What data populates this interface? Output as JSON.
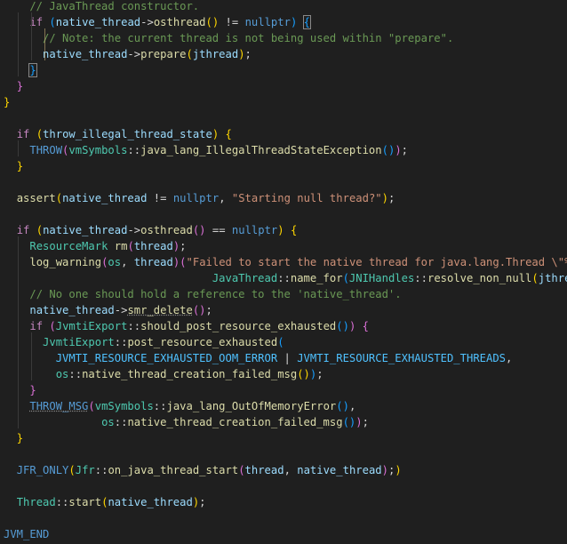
{
  "editor": {
    "lines": [
      {
        "kind": "plain",
        "text": "    // JavaThread constructor."
      },
      {
        "kind": "l01"
      },
      {
        "kind": "l02"
      },
      {
        "kind": "l03"
      },
      {
        "kind": "l04"
      },
      {
        "kind": "l05"
      },
      {
        "kind": "l06"
      },
      {
        "kind": "blank"
      },
      {
        "kind": "l08"
      },
      {
        "kind": "l09"
      },
      {
        "kind": "l10"
      },
      {
        "kind": "blank"
      },
      {
        "kind": "l12"
      },
      {
        "kind": "blank"
      },
      {
        "kind": "l14"
      },
      {
        "kind": "l15"
      },
      {
        "kind": "l16"
      },
      {
        "kind": "l17"
      },
      {
        "kind": "l18"
      },
      {
        "kind": "l19"
      },
      {
        "kind": "l20"
      },
      {
        "kind": "l21"
      },
      {
        "kind": "l22"
      },
      {
        "kind": "l23"
      },
      {
        "kind": "l24"
      },
      {
        "kind": "l25"
      },
      {
        "kind": "l26"
      },
      {
        "kind": "l27"
      },
      {
        "kind": "blank"
      },
      {
        "kind": "l29"
      },
      {
        "kind": "blank"
      },
      {
        "kind": "l31"
      },
      {
        "kind": "blank"
      },
      {
        "kind": "l33"
      }
    ]
  },
  "tokens": {
    "l01": [
      [
        "    ",
        "o"
      ],
      [
        "if",
        "k"
      ],
      [
        " ",
        "o"
      ],
      [
        "(",
        "b3"
      ],
      [
        "native_thread",
        "v"
      ],
      [
        "->",
        "o"
      ],
      [
        "osthread",
        "f"
      ],
      [
        "()",
        "b1"
      ],
      [
        " != ",
        "o"
      ],
      [
        "nullptr",
        "n"
      ],
      [
        ")",
        "b3"
      ],
      [
        " ",
        "o"
      ],
      [
        "{",
        "b3"
      ]
    ],
    "l02": [
      [
        "      ",
        "o"
      ],
      [
        "// Note: the current thread is not being used within \"prepare\".",
        "c"
      ]
    ],
    "l03": [
      [
        "      ",
        "o"
      ],
      [
        "native_thread",
        "v"
      ],
      [
        "->",
        "o"
      ],
      [
        "prepare",
        "f"
      ],
      [
        "(",
        "b1"
      ],
      [
        "jthread",
        "v"
      ],
      [
        ")",
        "b1"
      ],
      [
        ";",
        "o"
      ]
    ],
    "l04": [
      [
        "    ",
        "o"
      ],
      [
        "}",
        "b3"
      ]
    ],
    "l05": [
      [
        "  ",
        "o"
      ],
      [
        "}",
        "b2"
      ]
    ],
    "l06": [
      [
        "}",
        "b1"
      ]
    ],
    "l08": [
      [
        "  ",
        "o"
      ],
      [
        "if",
        "k"
      ],
      [
        " ",
        "o"
      ],
      [
        "(",
        "b1"
      ],
      [
        "throw_illegal_thread_state",
        "v"
      ],
      [
        ")",
        "b1"
      ],
      [
        " ",
        "o"
      ],
      [
        "{",
        "b1"
      ]
    ],
    "l09": [
      [
        "    ",
        "o"
      ],
      [
        "THROW",
        "n"
      ],
      [
        "(",
        "b2"
      ],
      [
        "vmSymbols",
        "t"
      ],
      [
        "::",
        "o"
      ],
      [
        "java_lang_IllegalThreadStateException",
        "f"
      ],
      [
        "()",
        "b3"
      ],
      [
        ")",
        "b2"
      ],
      [
        ";",
        "o"
      ]
    ],
    "l10": [
      [
        "  ",
        "o"
      ],
      [
        "}",
        "b1"
      ]
    ],
    "l12": [
      [
        "  ",
        "o"
      ],
      [
        "assert",
        "f"
      ],
      [
        "(",
        "b1"
      ],
      [
        "native_thread",
        "v"
      ],
      [
        " != ",
        "o"
      ],
      [
        "nullptr",
        "n"
      ],
      [
        ", ",
        "o"
      ],
      [
        "\"Starting null thread?\"",
        "s"
      ],
      [
        ")",
        "b1"
      ],
      [
        ";",
        "o"
      ]
    ],
    "l14": [
      [
        "  ",
        "o"
      ],
      [
        "if",
        "k"
      ],
      [
        " ",
        "o"
      ],
      [
        "(",
        "b1"
      ],
      [
        "native_thread",
        "v"
      ],
      [
        "->",
        "o"
      ],
      [
        "osthread",
        "f"
      ],
      [
        "()",
        "b2"
      ],
      [
        " == ",
        "o"
      ],
      [
        "nullptr",
        "n"
      ],
      [
        ")",
        "b1"
      ],
      [
        " ",
        "o"
      ],
      [
        "{",
        "b1"
      ]
    ],
    "l15": [
      [
        "    ",
        "o"
      ],
      [
        "ResourceMark",
        "t"
      ],
      [
        " ",
        "o"
      ],
      [
        "rm",
        "f"
      ],
      [
        "(",
        "b2"
      ],
      [
        "thread",
        "v"
      ],
      [
        ")",
        "b2"
      ],
      [
        ";",
        "o"
      ]
    ],
    "l16": [
      [
        "    ",
        "o"
      ],
      [
        "log_warning",
        "f"
      ],
      [
        "(",
        "b2"
      ],
      [
        "os",
        "t"
      ],
      [
        ", ",
        "o"
      ],
      [
        "thread",
        "v"
      ],
      [
        ")",
        "b2"
      ],
      [
        "(",
        "b2"
      ],
      [
        "\"Failed to start the native thread for java.lang.Thread \\\"%",
        "s"
      ]
    ],
    "l17": [
      [
        "                                ",
        "o"
      ],
      [
        "JavaThread",
        "t"
      ],
      [
        "::",
        "o"
      ],
      [
        "name_for",
        "f"
      ],
      [
        "(",
        "b3"
      ],
      [
        "JNIHandles",
        "t"
      ],
      [
        "::",
        "o"
      ],
      [
        "resolve_non_null",
        "f"
      ],
      [
        "(",
        "b1"
      ],
      [
        "jthread",
        "v"
      ],
      [
        ")",
        "b1"
      ],
      [
        ")",
        "b3"
      ]
    ],
    "l18": [
      [
        "    ",
        "o"
      ],
      [
        "// No one should hold a reference to the 'native_thread'.",
        "c"
      ]
    ],
    "l19": [
      [
        "    ",
        "o"
      ],
      [
        "native_thread",
        "v"
      ],
      [
        "->",
        "o"
      ],
      [
        "smr_delete",
        "f"
      ],
      [
        "()",
        "b2"
      ],
      [
        ";",
        "o"
      ]
    ],
    "l20": [
      [
        "    ",
        "o"
      ],
      [
        "if",
        "k"
      ],
      [
        " ",
        "o"
      ],
      [
        "(",
        "b2"
      ],
      [
        "JvmtiExport",
        "t"
      ],
      [
        "::",
        "o"
      ],
      [
        "should_post_resource_exhausted",
        "f"
      ],
      [
        "()",
        "b3"
      ],
      [
        ")",
        "b2"
      ],
      [
        " ",
        "o"
      ],
      [
        "{",
        "b2"
      ]
    ],
    "l21": [
      [
        "      ",
        "o"
      ],
      [
        "JvmtiExport",
        "t"
      ],
      [
        "::",
        "o"
      ],
      [
        "post_resource_exhausted",
        "f"
      ],
      [
        "(",
        "b3"
      ]
    ],
    "l22": [
      [
        "        ",
        "o"
      ],
      [
        "JVMTI_RESOURCE_EXHAUSTED_OOM_ERROR",
        "m"
      ],
      [
        " | ",
        "o"
      ],
      [
        "JVMTI_RESOURCE_EXHAUSTED_THREADS",
        "m"
      ],
      [
        ",",
        "o"
      ]
    ],
    "l23": [
      [
        "        ",
        "o"
      ],
      [
        "os",
        "t"
      ],
      [
        "::",
        "o"
      ],
      [
        "native_thread_creation_failed_msg",
        "f"
      ],
      [
        "()",
        "b1"
      ],
      [
        ")",
        "b3"
      ],
      [
        ";",
        "o"
      ]
    ],
    "l24": [
      [
        "    ",
        "o"
      ],
      [
        "}",
        "b2"
      ]
    ],
    "l25": [
      [
        "    ",
        "o"
      ],
      [
        "THROW_MSG",
        "n"
      ],
      [
        "(",
        "b2"
      ],
      [
        "vmSymbols",
        "t"
      ],
      [
        "::",
        "o"
      ],
      [
        "java_lang_OutOfMemoryError",
        "f"
      ],
      [
        "()",
        "b3"
      ],
      [
        ",",
        "o"
      ]
    ],
    "l26": [
      [
        "               ",
        "o"
      ],
      [
        "os",
        "t"
      ],
      [
        "::",
        "o"
      ],
      [
        "native_thread_creation_failed_msg",
        "f"
      ],
      [
        "()",
        "b3"
      ],
      [
        ")",
        "b2"
      ],
      [
        ";",
        "o"
      ]
    ],
    "l27": [
      [
        "  ",
        "o"
      ],
      [
        "}",
        "b1"
      ]
    ],
    "l29": [
      [
        "  ",
        "o"
      ],
      [
        "JFR_ONLY",
        "n"
      ],
      [
        "(",
        "b1"
      ],
      [
        "Jfr",
        "t"
      ],
      [
        "::",
        "o"
      ],
      [
        "on_java_thread_start",
        "f"
      ],
      [
        "(",
        "b2"
      ],
      [
        "thread",
        "v"
      ],
      [
        ", ",
        "o"
      ],
      [
        "native_thread",
        "v"
      ],
      [
        ")",
        "b2"
      ],
      [
        ";",
        "o"
      ],
      [
        ")",
        "b1"
      ]
    ],
    "l31": [
      [
        "  ",
        "o"
      ],
      [
        "Thread",
        "t"
      ],
      [
        "::",
        "o"
      ],
      [
        "start",
        "f"
      ],
      [
        "(",
        "b1"
      ],
      [
        "native_thread",
        "v"
      ],
      [
        ")",
        "b1"
      ],
      [
        ";",
        "o"
      ]
    ],
    "l33": [
      [
        "JVM_END",
        "n"
      ]
    ]
  },
  "colors": {
    "background": "#1f1f1f",
    "keyword": "#c586c0",
    "function": "#dcdcaa",
    "variable": "#9cdcfe",
    "type": "#4ec9b0",
    "string": "#ce9178",
    "comment": "#6a9955",
    "constant": "#569cd6",
    "enum_constant": "#4fc1ff",
    "bracket_1": "#ffd700",
    "bracket_2": "#da70d6",
    "bracket_3": "#179fff"
  }
}
